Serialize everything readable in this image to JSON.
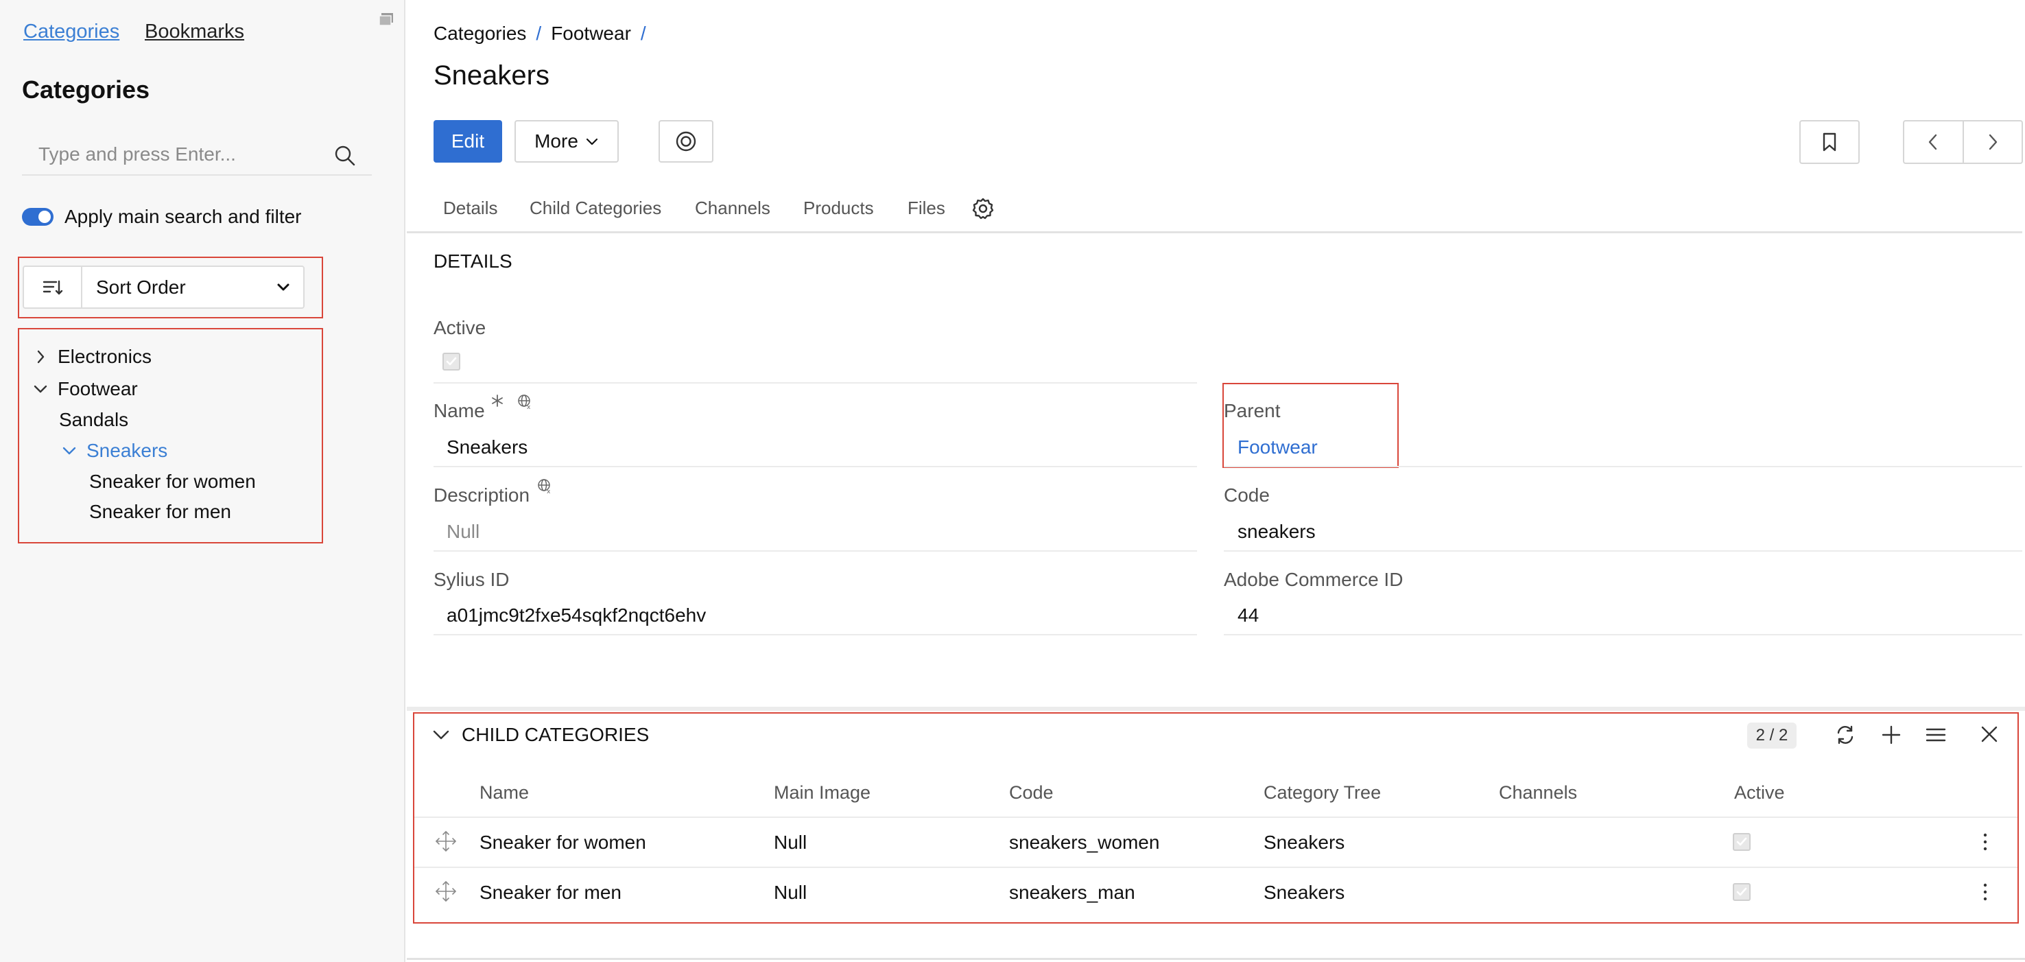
{
  "sidebar": {
    "tabs": [
      "Categories",
      "Bookmarks"
    ],
    "title": "Categories",
    "search_placeholder": "Type and press Enter...",
    "toggle_label": "Apply main search and filter",
    "sort_label": "Sort Order",
    "tree": [
      {
        "label": "Electronics",
        "expanded": false
      },
      {
        "label": "Footwear",
        "expanded": true
      },
      {
        "label": "Sandals"
      },
      {
        "label": "Sneakers",
        "expanded": true,
        "selected": true
      },
      {
        "label": "Sneaker for women"
      },
      {
        "label": "Sneaker for men"
      }
    ]
  },
  "header": {
    "breadcrumb": [
      "Categories",
      "Footwear"
    ],
    "breadcrumb_sep": "/",
    "title": "Sneakers",
    "edit_label": "Edit",
    "more_label": "More"
  },
  "tabs": [
    "Details",
    "Child Categories",
    "Channels",
    "Products",
    "Files"
  ],
  "details": {
    "heading": "DETAILS",
    "active_label": "Active",
    "name_label": "Name",
    "name_value": "Sneakers",
    "parent_label": "Parent",
    "parent_value": "Footwear",
    "description_label": "Description",
    "description_value": "Null",
    "code_label": "Code",
    "code_value": "sneakers",
    "sylius_label": "Sylius ID",
    "sylius_value": "a01jmc9t2fxe54sqkf2nqct6ehv",
    "adobe_label": "Adobe Commerce ID",
    "adobe_value": "44"
  },
  "child_categories": {
    "title": "CHILD CATEGORIES",
    "count": "2 / 2",
    "columns": [
      "Name",
      "Main Image",
      "Code",
      "Category Tree",
      "Channels",
      "Active"
    ],
    "rows": [
      {
        "name": "Sneaker for women",
        "main_image": "Null",
        "code": "sneakers_women",
        "category_tree": "Sneakers",
        "channels": "",
        "active": true
      },
      {
        "name": "Sneaker for men",
        "main_image": "Null",
        "code": "sneakers_man",
        "category_tree": "Sneakers",
        "channels": "",
        "active": true
      }
    ]
  },
  "colors": {
    "accent": "#2f6ed1",
    "link": "#3b7fd4",
    "highlight_border": "#d9463a",
    "sidebar_bg": "#f7f7f7"
  },
  "icons": [
    "collapse-icon",
    "search-icon",
    "sort-icon",
    "chevron-down-icon",
    "chevron-right-icon",
    "target-icon",
    "bookmark-icon",
    "arrow-left-icon",
    "arrow-right-icon",
    "gear-icon",
    "required-asterisk-icon",
    "translate-icon",
    "refresh-icon",
    "plus-icon",
    "menu-icon",
    "close-icon",
    "drag-icon",
    "kebab-icon"
  ]
}
